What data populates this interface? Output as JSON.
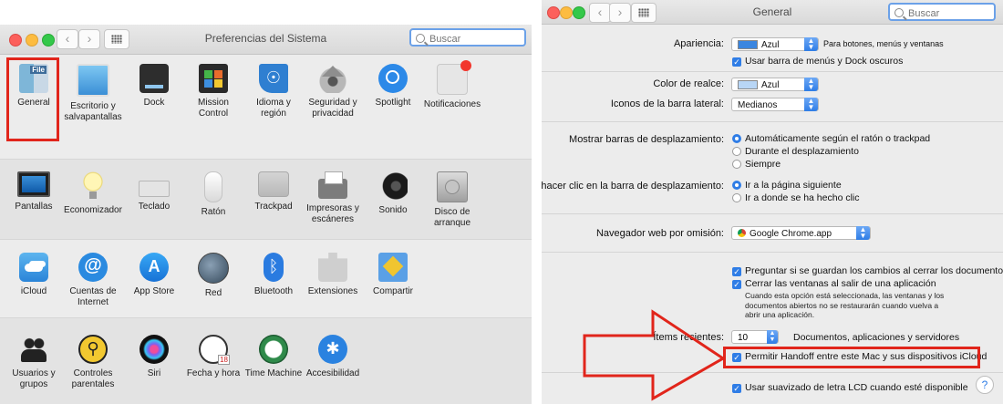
{
  "left": {
    "title": "Preferencias del Sistema",
    "search_placeholder": "Buscar",
    "rows": [
      [
        {
          "label": "General",
          "icon": "general-icon"
        },
        {
          "label": "Escritorio y salvapantallas",
          "icon": "desktop-icon"
        },
        {
          "label": "Dock",
          "icon": "dock-icon"
        },
        {
          "label": "Mission Control",
          "icon": "mission-control-icon"
        },
        {
          "label": "Idioma y región",
          "icon": "language-icon"
        },
        {
          "label": "Seguridad y privacidad",
          "icon": "security-icon"
        },
        {
          "label": "Spotlight",
          "icon": "spotlight-icon"
        },
        {
          "label": "Notificaciones",
          "icon": "notifications-icon"
        }
      ],
      [
        {
          "label": "Pantallas",
          "icon": "displays-icon"
        },
        {
          "label": "Economizador",
          "icon": "energy-saver-icon"
        },
        {
          "label": "Teclado",
          "icon": "keyboard-icon"
        },
        {
          "label": "Ratón",
          "icon": "mouse-icon"
        },
        {
          "label": "Trackpad",
          "icon": "trackpad-icon"
        },
        {
          "label": "Impresoras y escáneres",
          "icon": "printer-icon"
        },
        {
          "label": "Sonido",
          "icon": "sound-icon"
        },
        {
          "label": "Disco de arranque",
          "icon": "startup-disk-icon"
        }
      ],
      [
        {
          "label": "iCloud",
          "icon": "icloud-icon"
        },
        {
          "label": "Cuentas de Internet",
          "icon": "internet-accounts-icon"
        },
        {
          "label": "App Store",
          "icon": "app-store-icon"
        },
        {
          "label": "Red",
          "icon": "network-icon"
        },
        {
          "label": "Bluetooth",
          "icon": "bluetooth-icon"
        },
        {
          "label": "Extensiones",
          "icon": "extensions-icon"
        },
        {
          "label": "Compartir",
          "icon": "sharing-icon"
        }
      ],
      [
        {
          "label": "Usuarios y grupos",
          "icon": "users-icon"
        },
        {
          "label": "Controles parentales",
          "icon": "parental-controls-icon"
        },
        {
          "label": "Siri",
          "icon": "siri-icon"
        },
        {
          "label": "Fecha y hora",
          "icon": "date-time-icon"
        },
        {
          "label": "Time Machine",
          "icon": "time-machine-icon"
        },
        {
          "label": "Accesibilidad",
          "icon": "accessibility-icon"
        }
      ]
    ]
  },
  "right": {
    "title": "General",
    "search_placeholder": "Buscar",
    "appearance_label": "Apariencia:",
    "appearance_value": "Azul",
    "appearance_note": "Para botones, menús y ventanas",
    "dark_menu": "Usar barra de menús y Dock oscuros",
    "highlight_label": "Color de realce:",
    "highlight_value": "Azul",
    "sidebar_label": "Iconos de la barra lateral:",
    "sidebar_value": "Medianos",
    "scroll_label": "Mostrar barras de desplazamiento:",
    "scroll_opt1": "Automáticamente según el ratón o trackpad",
    "scroll_opt2": "Durante el desplazamiento",
    "scroll_opt3": "Siempre",
    "click_label": "Al hacer clic en la barra de desplazamiento:",
    "click_opt1": "Ir a la página siguiente",
    "click_opt2": "Ir a donde se ha hecho clic",
    "browser_label": "Navegador web por omisión:",
    "browser_value": "Google Chrome.app",
    "ask_save": "Preguntar si se guardan los cambios al cerrar los documentos",
    "close_windows": "Cerrar las ventanas al salir de una aplicación",
    "close_note_1": "Cuando esta opción está seleccionada, las ventanas y los",
    "close_note_2": "documentos abiertos no se restaurarán cuando vuelva a",
    "close_note_3": "abrir una aplicación.",
    "recent_label": "Ítems recientes:",
    "recent_value": "10",
    "recent_note": "Documentos, aplicaciones y servidores",
    "handoff": "Permitir Handoff entre este Mac y sus dispositivos iCloud",
    "lcd": "Usar suavizado de letra LCD cuando esté disponible",
    "help": "?"
  },
  "colors": {
    "accent": "#2f7de6",
    "highlight_box": "#e1251b",
    "arrow": "#e1251b"
  }
}
